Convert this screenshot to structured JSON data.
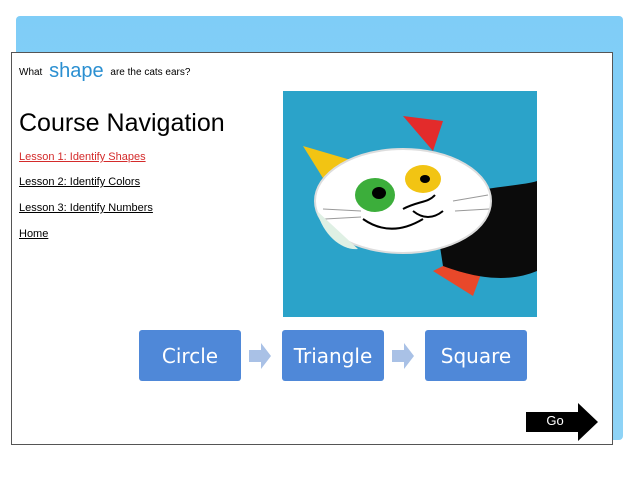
{
  "question": {
    "prefix": "What",
    "keyword": "shape",
    "suffix": "are the cats ears?"
  },
  "course_nav": {
    "title": "Course Navigation",
    "links": [
      {
        "label": "Lesson 1: Identify Shapes",
        "active": true
      },
      {
        "label": "Lesson 2: Identify Colors",
        "active": false
      },
      {
        "label": "Lesson 3: Identify Numbers",
        "active": false
      },
      {
        "label": "Home",
        "active": false
      }
    ]
  },
  "options": [
    "Circle",
    "Triangle",
    "Square"
  ],
  "go_button": {
    "label": "Go"
  },
  "colors": {
    "accent": "#2a8fd1",
    "option_fill": "#4f88d8",
    "active_link": "#d42b2b",
    "page_band": "#7fcdf7"
  }
}
